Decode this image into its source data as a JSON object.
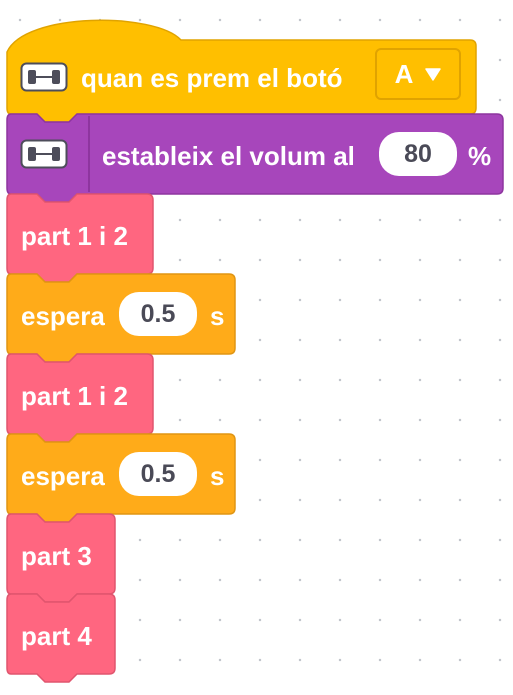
{
  "colors": {
    "events": "#FFBF00",
    "events_dark": "#E0A300",
    "sound": "#A746BB",
    "sound_dark": "#8E359F",
    "my_blocks": "#FF6680",
    "my_blocks_dark": "#E0556E",
    "control": "#FFAB19",
    "control_dark": "#E09513",
    "workspace_dot": "#C2C6CC"
  },
  "blocks": [
    {
      "category": "events",
      "icon": "hub-icon",
      "text": "quan es prem el botó",
      "dropdown": "A",
      "dropdown_icon": "triangle-down-icon"
    },
    {
      "category": "sound",
      "icon": "hub-icon",
      "text": "estableix el volum al",
      "value": "80",
      "suffix": "%"
    },
    {
      "category": "my_blocks",
      "text": "part 1 i 2"
    },
    {
      "category": "control",
      "text": "espera",
      "value": "0.5",
      "suffix": "s"
    },
    {
      "category": "my_blocks",
      "text": "part 1 i 2"
    },
    {
      "category": "control",
      "text": "espera",
      "value": "0.5",
      "suffix": "s"
    },
    {
      "category": "my_blocks",
      "text": "part 3"
    },
    {
      "category": "my_blocks",
      "text": "part 4"
    }
  ]
}
